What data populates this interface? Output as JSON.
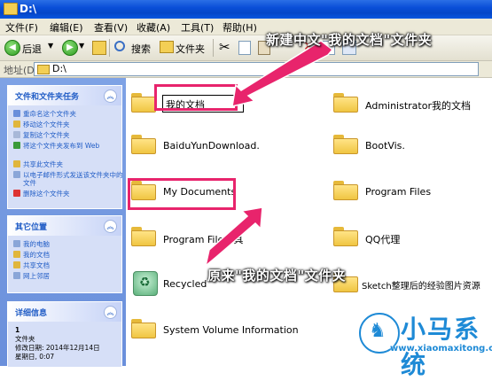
{
  "window": {
    "title": "D:\\"
  },
  "menu": [
    "文件(F)",
    "编辑(E)",
    "查看(V)",
    "收藏(A)",
    "工具(T)",
    "帮助(H)"
  ],
  "toolbar": {
    "back": "后退",
    "search": "搜索",
    "folders": "文件夹"
  },
  "address": {
    "label": "地址(D)",
    "value": "D:\\"
  },
  "taskpane": {
    "file_tasks": {
      "title": "文件和文件夹任务",
      "items": [
        "重命名这个文件夹",
        "移动这个文件夹",
        "复制这个文件夹",
        "将这个文件夹发布到 Web",
        "共享此文件夹",
        "以电子邮件形式发送该文件夹中的文件",
        "删除这个文件夹"
      ]
    },
    "other_places": {
      "title": "其它位置",
      "items": [
        "我的电脑",
        "我的文档",
        "共享文档",
        "网上邻居"
      ]
    },
    "details": {
      "title": "详细信息",
      "lines": [
        "1",
        "文件夹",
        "修改日期: 2014年12月14日",
        "星期日, 0:07"
      ]
    }
  },
  "files": {
    "left": [
      {
        "name": "我的文档",
        "editing": true
      },
      {
        "name": "BaiduYunDownload."
      },
      {
        "name": "My Documents",
        "highlighted": true
      },
      {
        "name": "Program File工具"
      },
      {
        "name": "Recycled",
        "icon": "recycle-bin-icon"
      },
      {
        "name": "System Volume Information"
      }
    ],
    "right": [
      {
        "name": "Administrator我的文档"
      },
      {
        "name": "BootVis."
      },
      {
        "name": "Program Files"
      },
      {
        "name": "QQ代理"
      },
      {
        "name": "Sketch整理后的经验图片资源"
      }
    ]
  },
  "annotations": {
    "top": "新建中文\"我的文档\"文件夹",
    "bottom": "原来\"我的文档\"文件夹",
    "color": "#e8246c"
  },
  "watermark": {
    "brand": "小马系统",
    "url": "www.xiaomaxitong.com",
    "color": "#1e8ad6"
  }
}
